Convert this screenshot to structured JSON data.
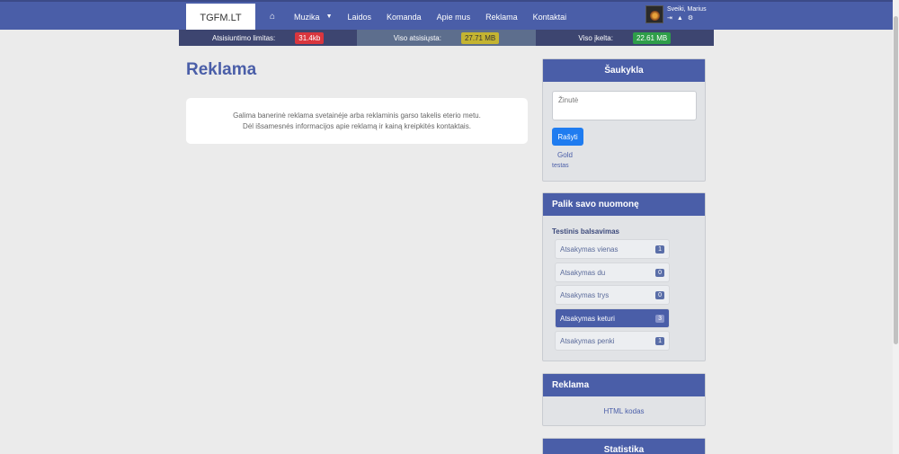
{
  "nav": {
    "brand": "TGFM.LT",
    "items": [
      {
        "label": "Muzika",
        "dropdown": true
      },
      {
        "label": "Laidos"
      },
      {
        "label": "Komanda"
      },
      {
        "label": "Apie mus"
      },
      {
        "label": "Reklama"
      },
      {
        "label": "Kontaktai"
      }
    ],
    "user_greeting": "Sveiki, Marius"
  },
  "stats": [
    {
      "label": "Atsisiuntimo limitas:",
      "value": "31.4kb"
    },
    {
      "label": "Viso atsisiųsta:",
      "value": "27.71 MB"
    },
    {
      "label": "Viso įkelta:",
      "value": "22.61 MB"
    }
  ],
  "main": {
    "title": "Reklama",
    "line1": "Galima banerinė reklama svetainėje arba reklaminis garso takelis eterio metu.",
    "line2": "Dėl išsamesnės informacijos apie reklamą ir kainą kreipkitės kontaktais."
  },
  "shoutbox": {
    "title": "Šaukykla",
    "placeholder": "Žinutė",
    "button": "Rašyti",
    "last_user": "Gold",
    "last_message": "testas"
  },
  "poll": {
    "title": "Palik savo nuomonę",
    "question": "Testinis balsavimas",
    "options": [
      {
        "label": "Atsakymas vienas",
        "count": "1"
      },
      {
        "label": "Atsakymas du",
        "count": "0"
      },
      {
        "label": "Atsakymas trys",
        "count": "0"
      },
      {
        "label": "Atsakymas keturi",
        "count": "3"
      },
      {
        "label": "Atsakymas penki",
        "count": "1"
      }
    ]
  },
  "ad_box": {
    "title": "Reklama",
    "link": "HTML kodas"
  },
  "stats_box": {
    "title": "Statistika"
  },
  "colors": {
    "primary": "#4a5ea8",
    "button": "#1f7cf0",
    "badge_red": "#d9363e",
    "badge_yellow": "#c4b431",
    "badge_green": "#2f9e4a"
  }
}
